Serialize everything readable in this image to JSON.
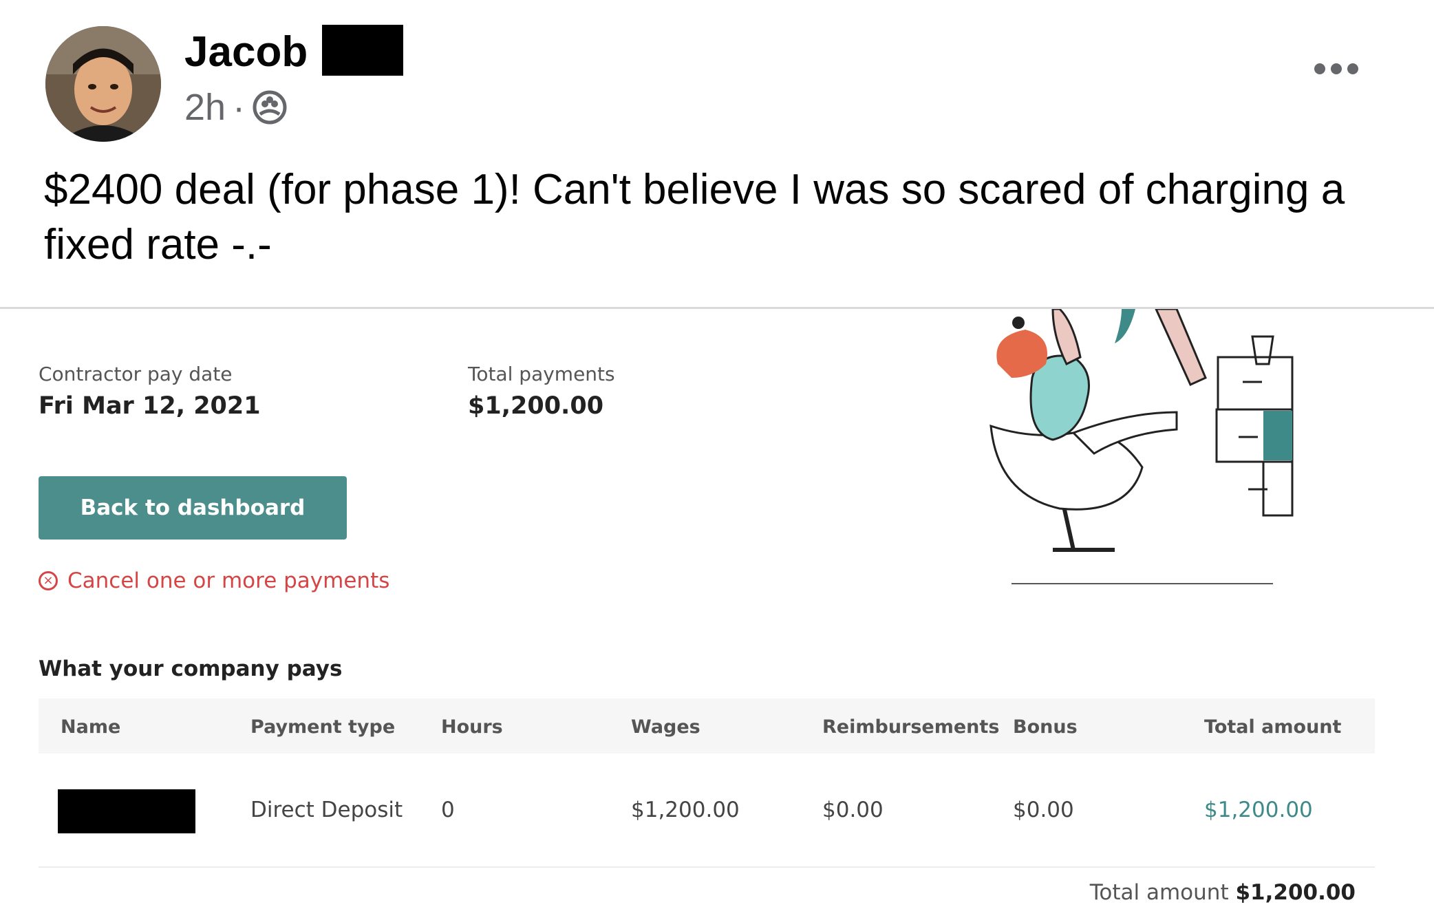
{
  "post": {
    "author": "Jacob",
    "time": "2h",
    "audience_icon": "friends-icon",
    "more_icon": "more-options-icon",
    "text": "$2400 deal (for phase 1)! Can't believe I was so scared of charging a fixed rate -.-"
  },
  "screenshot": {
    "pay_date_label": "Contractor pay date",
    "pay_date": "Fri Mar 12, 2021",
    "total_payments_label": "Total payments",
    "total_payments": "$1,200.00",
    "back_button": "Back to dashboard",
    "cancel_link": "Cancel one or more payments",
    "section_title": "What your company pays",
    "columns": [
      "Name",
      "Payment type",
      "Hours",
      "Wages",
      "Reimbursements",
      "Bonus",
      "Total amount"
    ],
    "row": {
      "payment_type": "Direct Deposit",
      "hours": "0",
      "wages": "$1,200.00",
      "reimbursements": "$0.00",
      "bonus": "$0.00",
      "total": "$1,200.00"
    },
    "total_label": "Total amount",
    "total_value": "$1,200.00",
    "colors": {
      "button": "#4b8e8c",
      "cancel": "#d64545",
      "accent": "#3d8a88"
    }
  }
}
